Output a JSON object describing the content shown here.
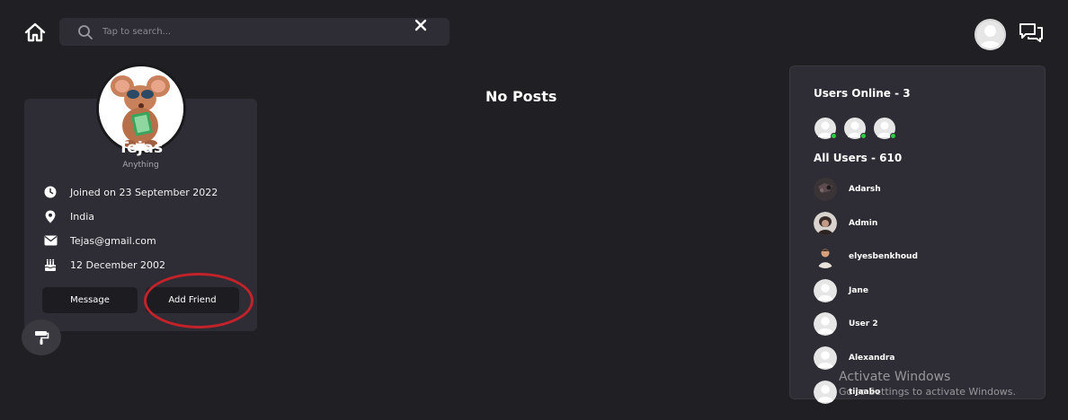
{
  "search": {
    "placeholder": "Tap to search..."
  },
  "profile": {
    "name": "Tejas",
    "bio": "Anything",
    "joined": "Joined on 23 September 2022",
    "location": "India",
    "email": "Tejas@gmail.com",
    "birthday": "12 December 2002",
    "message_label": "Message",
    "add_friend_label": "Add Friend"
  },
  "feed": {
    "empty_text": "No Posts"
  },
  "sidebar": {
    "online_title": "Users Online - 3",
    "all_title": "All Users - 610",
    "users": [
      {
        "name": "Adarsh",
        "avatar": "dark-photo"
      },
      {
        "name": "Admin",
        "avatar": "cartoon-photo"
      },
      {
        "name": "elyesbenkhoud",
        "avatar": "person-photo"
      },
      {
        "name": "Jane",
        "avatar": "default"
      },
      {
        "name": "User 2",
        "avatar": "default"
      },
      {
        "name": "Alexandra",
        "avatar": "default"
      },
      {
        "name": "tijaabo",
        "avatar": "default"
      }
    ]
  },
  "watermark": {
    "line1": "Activate Windows",
    "line2": "Go to Settings to activate Windows."
  },
  "colors": {
    "background": "#201f24",
    "card": "#2e2d35",
    "online": "#2ecc40",
    "highlight": "#c4222a"
  }
}
